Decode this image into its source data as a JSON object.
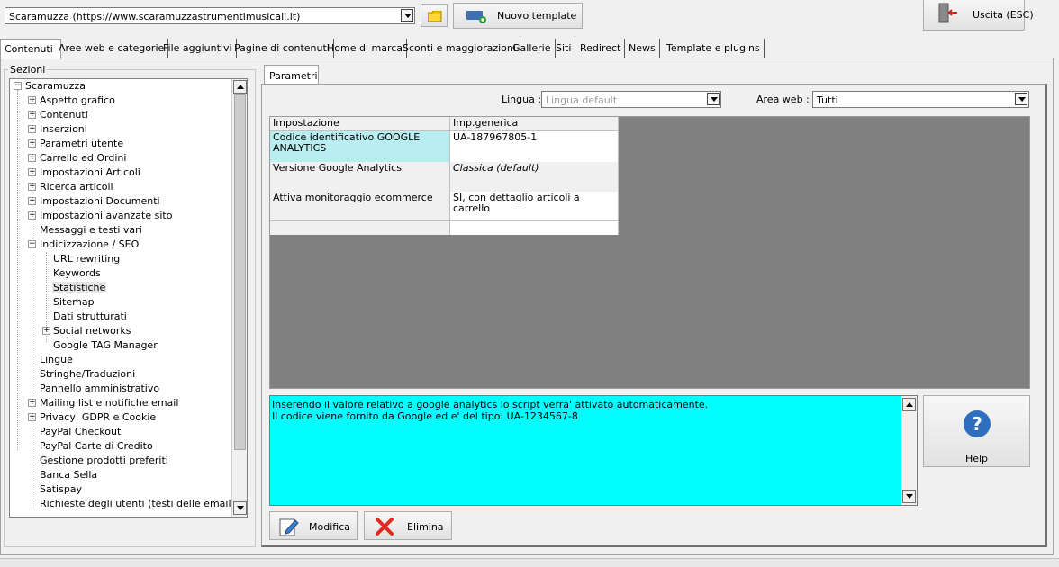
{
  "top": {
    "site_selector": "Scaramuzza (https://www.scaramuzzastrumentimusicali.it)",
    "new_template_label": "Nuovo template",
    "exit_label": "Uscita (ESC)"
  },
  "tabs": [
    {
      "label": "Contenuti"
    },
    {
      "label": "Aree web e categorie"
    },
    {
      "label": "File aggiuntivi"
    },
    {
      "label": "Pagine di contenuti"
    },
    {
      "label": "Home di marca"
    },
    {
      "label": "Sconti e maggiorazioni"
    },
    {
      "label": "Gallerie"
    },
    {
      "label": "Siti"
    },
    {
      "label": "Redirect"
    },
    {
      "label": "News"
    },
    {
      "label": "Template e plugins"
    }
  ],
  "sections": {
    "label": "Sezioni",
    "tree": [
      {
        "label": "Scaramuzza"
      },
      {
        "label": "Aspetto grafico"
      },
      {
        "label": "Contenuti"
      },
      {
        "label": "Inserzioni"
      },
      {
        "label": "Parametri utente"
      },
      {
        "label": "Carrello ed Ordini"
      },
      {
        "label": "Impostazioni Articoli"
      },
      {
        "label": "Ricerca articoli"
      },
      {
        "label": "Impostazioni Documenti"
      },
      {
        "label": "Impostazioni avanzate sito"
      },
      {
        "label": "Messaggi e testi vari"
      },
      {
        "label": "Indicizzazione / SEO"
      },
      {
        "label": "URL rewriting"
      },
      {
        "label": "Keywords"
      },
      {
        "label": "Statistiche"
      },
      {
        "label": "Sitemap"
      },
      {
        "label": "Dati strutturati"
      },
      {
        "label": "Social networks"
      },
      {
        "label": "Google TAG Manager"
      },
      {
        "label": "Lingue"
      },
      {
        "label": "Stringhe/Traduzioni"
      },
      {
        "label": "Pannello amministrativo"
      },
      {
        "label": "Mailing list e notifiche email"
      },
      {
        "label": "Privacy, GDPR e Cookie"
      },
      {
        "label": "PayPal Checkout"
      },
      {
        "label": "PayPal Carte di Credito"
      },
      {
        "label": "Gestione prodotti preferiti"
      },
      {
        "label": "Banca Sella"
      },
      {
        "label": "Satispay"
      },
      {
        "label": "Richieste degli utenti (testi delle email)"
      }
    ]
  },
  "params": {
    "tab_label": "Parametri",
    "lingua_label": "Lingua :",
    "lingua_value": "Lingua default",
    "area_label": "Area web :",
    "area_value": "Tutti",
    "grid": {
      "headers": [
        "Impostazione",
        "Imp.generica"
      ],
      "rows": [
        {
          "setting": "Codice identificativo GOOGLE ANALYTICS",
          "value": "UA-187967805-1"
        },
        {
          "setting": "Versione Google Analytics",
          "value": "Classica (default)"
        },
        {
          "setting": "Attiva monitoraggio ecommerce",
          "value": "SI, con dettaglio articoli a carrello"
        }
      ]
    },
    "description_line1": "Inserendo il valore relativo a google analytics lo script verra' attivato automaticamente.",
    "description_line2": "Il codice viene fornito da Google ed e' del tipo: UA-1234567-8",
    "help_label": "Help",
    "modifica_label": "Modifica",
    "elimina_label": "Elimina"
  },
  "colors": {
    "selected_cell": "#b9eef1",
    "description_bg": "#00ffff",
    "grid_empty_bg": "#808080"
  }
}
